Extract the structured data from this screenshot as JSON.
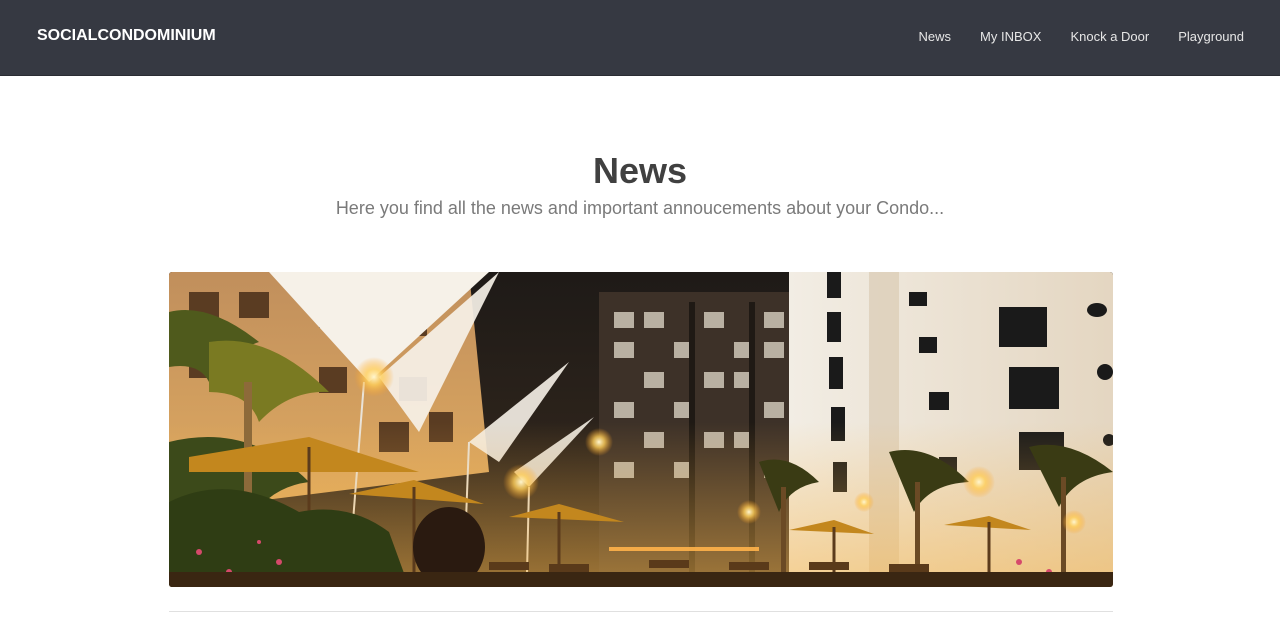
{
  "navbar": {
    "brand": "SOCIALCONDOMINIUM",
    "links": [
      {
        "label": "News"
      },
      {
        "label": "My INBOX"
      },
      {
        "label": "Knock a Door"
      },
      {
        "label": "Playground"
      }
    ]
  },
  "page": {
    "title": "News",
    "subtitle": "Here you find all the news and important annoucements about your Condo..."
  },
  "colors": {
    "navbar_bg": "#363942",
    "title": "#404040",
    "subtitle": "#7a7a7a"
  },
  "hero_image": {
    "icon": "condominium-night-photo"
  }
}
